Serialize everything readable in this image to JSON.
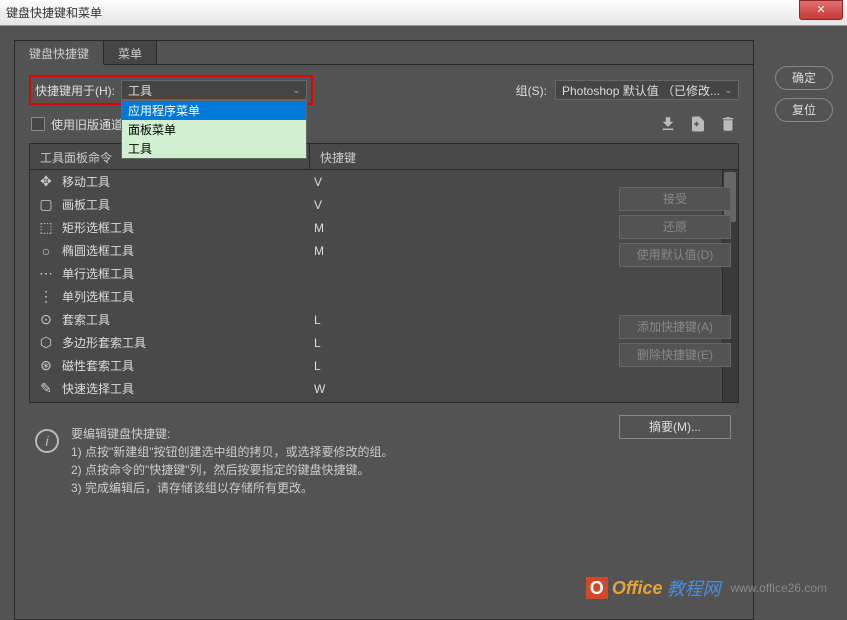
{
  "window": {
    "title": "键盘快捷键和菜单"
  },
  "tabs": {
    "shortcuts": "键盘快捷键",
    "menus": "菜单"
  },
  "shortcut_for": {
    "label": "快捷键用于(H):",
    "selected": "工具",
    "options": [
      "应用程序菜单",
      "面板菜单",
      "工具"
    ]
  },
  "group": {
    "label": "组(S):",
    "value": "Photoshop 默认值 （已修改..."
  },
  "legacy_checkbox": {
    "label": "使用旧版通道快"
  },
  "table": {
    "col1": "工具面板命令",
    "col2": "快捷键",
    "rows": [
      {
        "icon": "✥",
        "name": "移动工具",
        "key": "V"
      },
      {
        "icon": "▢",
        "name": "画板工具",
        "key": "V"
      },
      {
        "icon": "⬚",
        "name": "矩形选框工具",
        "key": "M"
      },
      {
        "icon": "○",
        "name": "椭圆选框工具",
        "key": "M"
      },
      {
        "icon": "⋯",
        "name": "单行选框工具",
        "key": ""
      },
      {
        "icon": "⋮",
        "name": "单列选框工具",
        "key": ""
      },
      {
        "icon": "⊙",
        "name": "套索工具",
        "key": "L"
      },
      {
        "icon": "⬡",
        "name": "多边形套索工具",
        "key": "L"
      },
      {
        "icon": "⊛",
        "name": "磁性套索工具",
        "key": "L"
      },
      {
        "icon": "✎",
        "name": "快速选择工具",
        "key": "W"
      }
    ]
  },
  "side_buttons": {
    "accept": "接受",
    "undo": "还原",
    "use_default": "使用默认值(D)",
    "add": "添加快捷键(A)",
    "delete": "删除快捷键(E)",
    "summary": "摘要(M)..."
  },
  "info": {
    "heading": "要编辑键盘快捷键:",
    "line1": "1) 点按\"新建组\"按钮创建选中组的拷贝，或选择要修改的组。",
    "line2": "2) 点按命令的\"快捷键\"列，然后按要指定的键盘快捷键。",
    "line3": "3) 完成编辑后，请存储该组以存储所有更改。"
  },
  "dialog_buttons": {
    "ok": "确定",
    "reset": "复位"
  },
  "watermark": {
    "brand1": "Office",
    "brand2": "教程网",
    "url": "www.office26.com"
  }
}
